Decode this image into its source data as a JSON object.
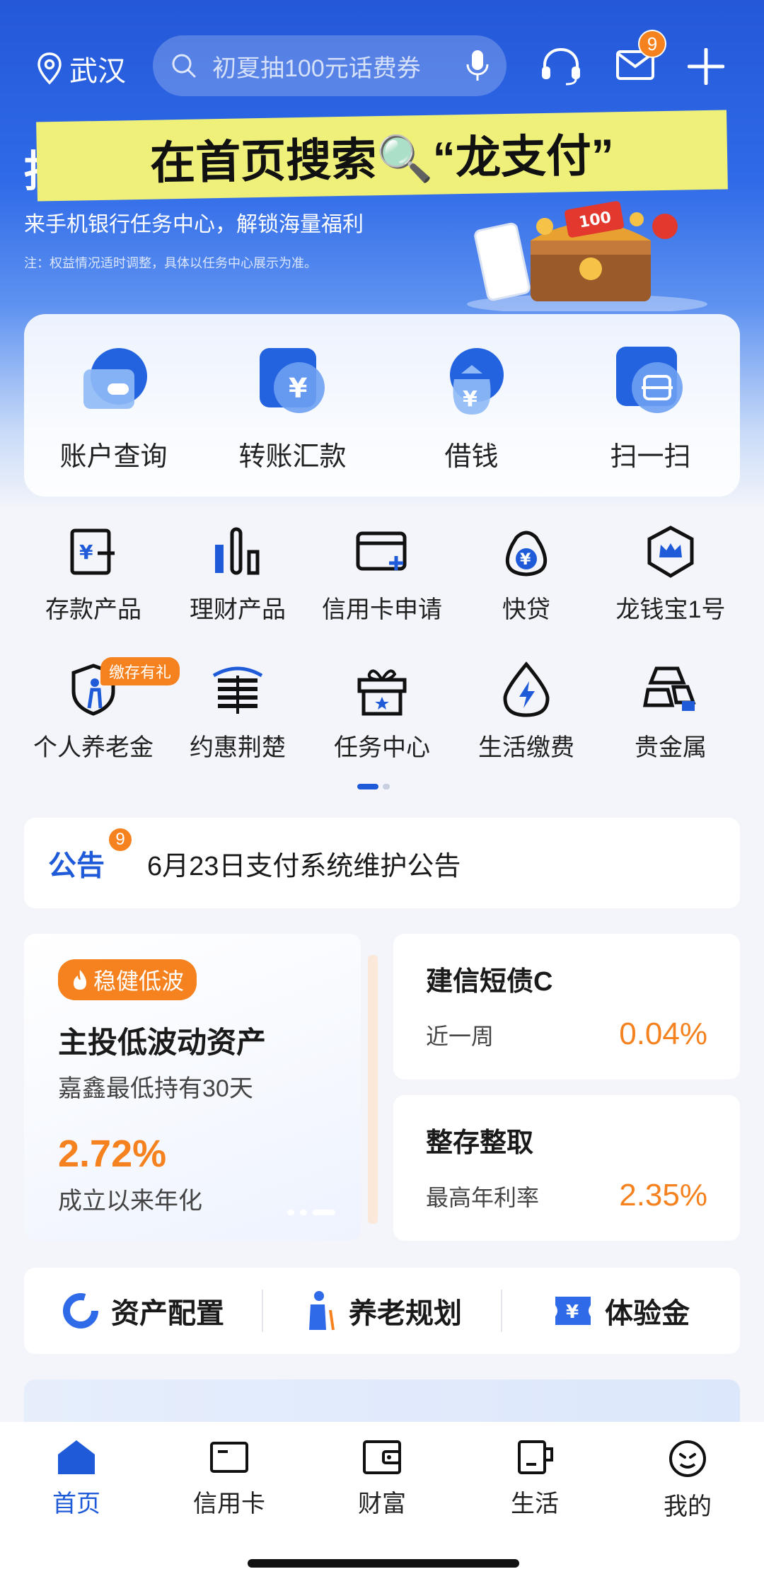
{
  "header": {
    "location": "武汉",
    "search_placeholder": "初夏抽100元话费券",
    "mail_badge": "9"
  },
  "banner": {
    "headline": "在首页搜索🔍“龙支付”",
    "tag": "抽",
    "subtitle": "来手机银行任务中心，解锁海量福利",
    "note": "注：权益情况适时调整，具体以任务中心展示为准。"
  },
  "quick_actions": [
    {
      "label": "账户查询",
      "icon": "wallet-icon"
    },
    {
      "label": "转账汇款",
      "icon": "transfer-icon"
    },
    {
      "label": "借钱",
      "icon": "money-bag-icon"
    },
    {
      "label": "扫一扫",
      "icon": "scan-icon"
    }
  ],
  "grid": {
    "row1": [
      {
        "label": "存款产品",
        "icon": "deposit-icon"
      },
      {
        "label": "理财产品",
        "icon": "bar-chart-icon"
      },
      {
        "label": "信用卡申请",
        "icon": "credit-card-add-icon"
      },
      {
        "label": "快贷",
        "icon": "loan-bag-icon"
      },
      {
        "label": "龙钱宝1号",
        "icon": "crown-shield-icon"
      }
    ],
    "row2": [
      {
        "label": "个人养老金",
        "icon": "pension-shield-icon",
        "badge": "缴存有礼"
      },
      {
        "label": "约惠荆楚",
        "icon": "pavilion-icon"
      },
      {
        "label": "任务中心",
        "icon": "gift-icon"
      },
      {
        "label": "生活缴费",
        "icon": "drop-bolt-icon"
      },
      {
        "label": "贵金属",
        "icon": "gold-bars-icon"
      }
    ]
  },
  "notice": {
    "tag": "公告",
    "badge": "9",
    "text": "6月23日支付系统维护公告"
  },
  "featured_product": {
    "tag": "稳健低波",
    "title": "主投低波动资产",
    "subtitle": "嘉鑫最低持有30天",
    "rate": "2.72%",
    "rate_label": "成立以来年化"
  },
  "products": [
    {
      "title": "建信短债C",
      "label": "近一周",
      "value": "0.04%"
    },
    {
      "title": "整存整取",
      "label": "最高年利率",
      "value": "2.35%"
    }
  ],
  "links": [
    {
      "label": "资产配置",
      "icon": "pie-chart-icon"
    },
    {
      "label": "养老规划",
      "icon": "elder-icon"
    },
    {
      "label": "体验金",
      "icon": "yen-ticket-icon"
    }
  ],
  "tabs": [
    {
      "label": "首页",
      "icon": "home-icon",
      "active": true
    },
    {
      "label": "信用卡",
      "icon": "card-icon"
    },
    {
      "label": "财富",
      "icon": "wallet-icon"
    },
    {
      "label": "生活",
      "icon": "cup-icon"
    },
    {
      "label": "我的",
      "icon": "profile-icon"
    }
  ],
  "colors": {
    "primary": "#1f5bd8",
    "accent": "#f5821f",
    "banner_yellow": "#eef07a"
  }
}
